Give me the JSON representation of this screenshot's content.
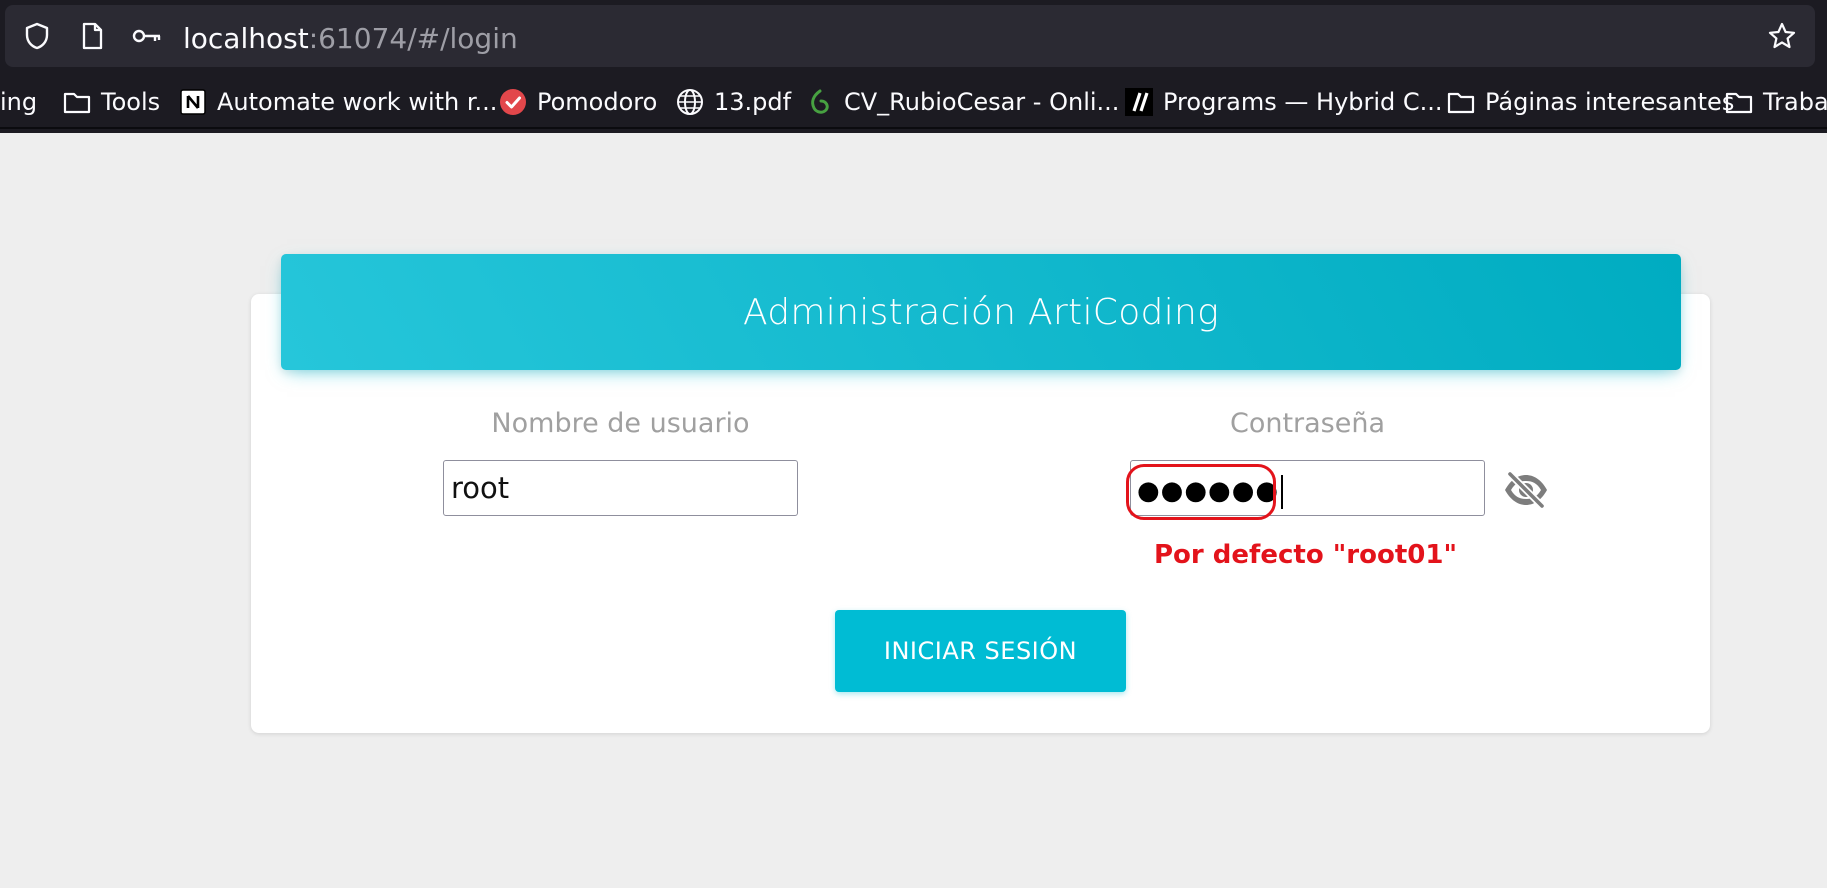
{
  "browser": {
    "url_host": "localhost",
    "url_rest": ":61074/#/login",
    "icons": [
      "shield-icon",
      "page-icon",
      "key-icon",
      "star-icon"
    ],
    "bookmarks": [
      {
        "label": "ing",
        "icon": "none"
      },
      {
        "label": "Tools",
        "icon": "folder-icon"
      },
      {
        "label": "Automate work with r...",
        "icon": "notion-icon"
      },
      {
        "label": "Pomodoro",
        "icon": "check-circle-icon"
      },
      {
        "label": "13.pdf",
        "icon": "globe-icon"
      },
      {
        "label": "CV_RubioCesar - Onli...",
        "icon": "overleaf-icon"
      },
      {
        "label": "Programs — Hybrid C...",
        "icon": "hybrid-icon"
      },
      {
        "label": "Páginas interesantes",
        "icon": "folder-icon"
      },
      {
        "label": "Trabaj",
        "icon": "folder-icon"
      }
    ]
  },
  "login": {
    "title": "Administración ArtiCoding",
    "username_label": "Nombre de usuario",
    "username_value": "root",
    "password_label": "Contraseña",
    "password_mask": "●●●●●●",
    "hint": "Por defecto \"root01\"",
    "submit_label": "INICIAR SESIÓN"
  },
  "colors": {
    "accent": "#00bcd4",
    "header_gradient_start": "#26c6da",
    "header_gradient_end": "#00acc1",
    "annotation": "#e3131b",
    "background": "#eeeeee"
  }
}
